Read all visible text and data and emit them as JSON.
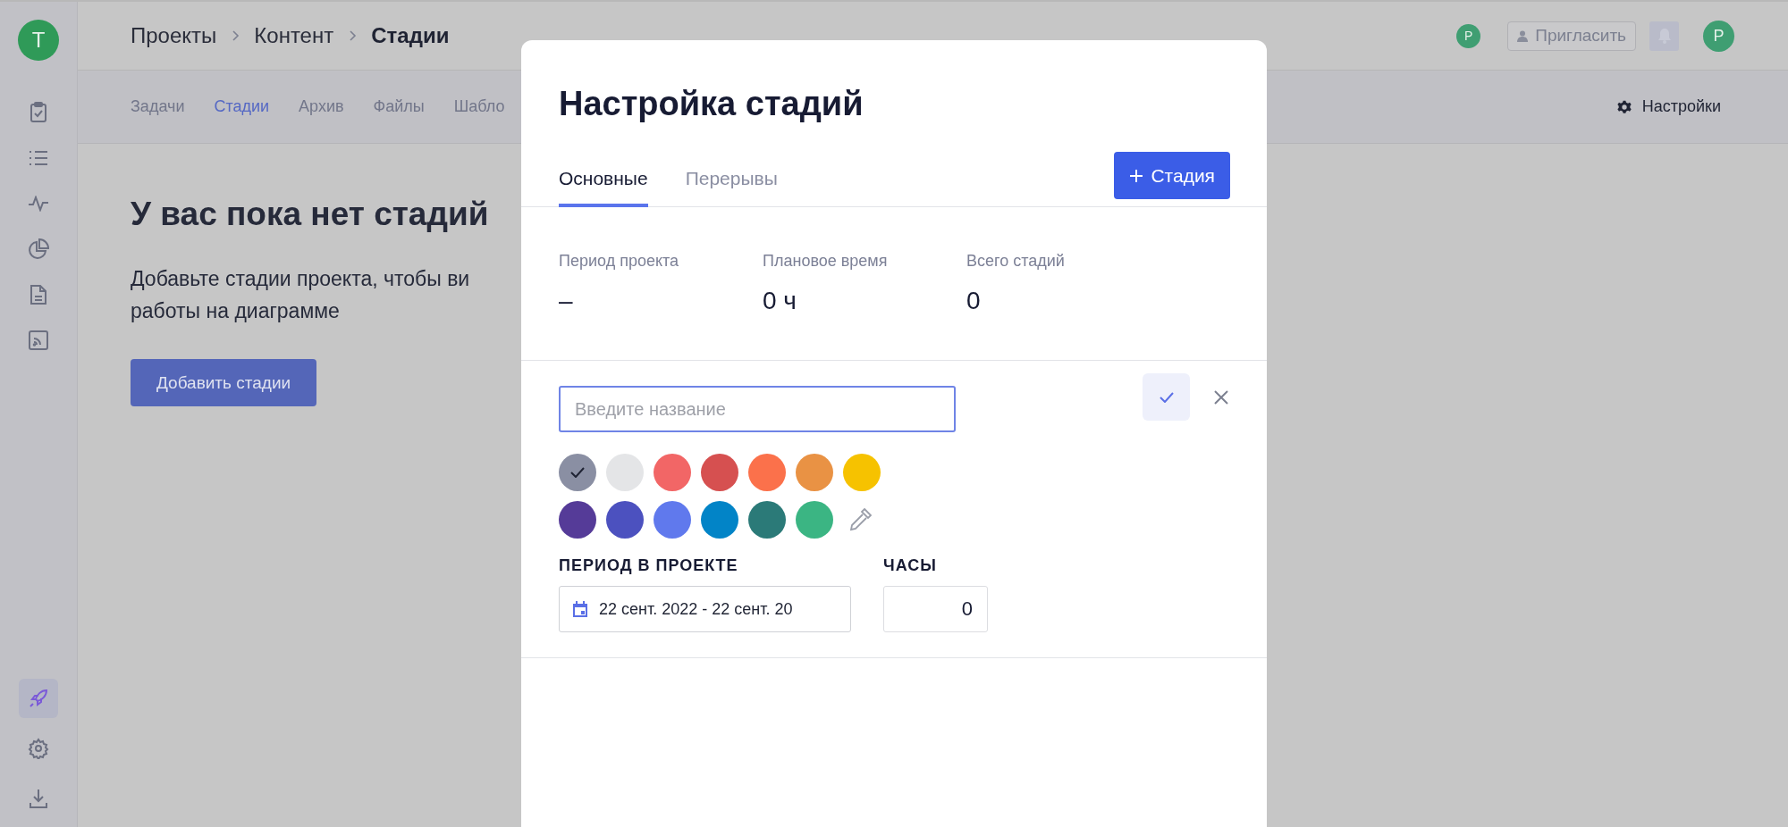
{
  "sidebar": {
    "avatar": "T",
    "items": [
      {
        "kind": "clipboard",
        "selected": false
      },
      {
        "kind": "list",
        "selected": false
      },
      {
        "kind": "pulse",
        "selected": false
      },
      {
        "kind": "pie",
        "selected": false
      },
      {
        "kind": "document",
        "selected": false
      },
      {
        "kind": "feed",
        "selected": false
      }
    ],
    "bottom_items": [
      {
        "kind": "rocket",
        "selected": true
      },
      {
        "kind": "settings",
        "selected": false
      },
      {
        "kind": "download",
        "selected": false
      }
    ]
  },
  "header": {
    "breadcrumbs": [
      "Проекты",
      "Контент",
      "Стадии"
    ],
    "member_avatar": "P",
    "invite_button": "Пригласить",
    "user_avatar": "P"
  },
  "subnav": {
    "tabs": [
      {
        "label": "Задачи",
        "selected": false
      },
      {
        "label": "Стадии",
        "selected": true
      },
      {
        "label": "Архив",
        "selected": false
      },
      {
        "label": "Файлы",
        "selected": false
      },
      {
        "label": "Шабло",
        "selected": false
      }
    ],
    "settings_link": "Настройки"
  },
  "empty_state": {
    "title": "У вас пока нет стадий",
    "lines": [
      "Добавьте стадии проекта, чтобы ви",
      "работы на диаграмме"
    ],
    "button": "Добавить стадии"
  },
  "modal": {
    "title": "Настройка стадий",
    "tabs": [
      {
        "label": "Основные",
        "selected": true
      },
      {
        "label": "Перерывы",
        "selected": false
      }
    ],
    "add_button": "Стадия",
    "stats": [
      {
        "label": "Период проекта",
        "value": "–"
      },
      {
        "label": "Плановое время",
        "value": "0 ч"
      },
      {
        "label": "Всего стадий",
        "value": "0"
      }
    ],
    "form": {
      "name_placeholder": "Введите название",
      "colors": [
        {
          "color": "#8a8fa3",
          "selected": true
        },
        {
          "color": "#e4e5e7",
          "selected": false
        },
        {
          "color": "#f26666",
          "selected": false
        },
        {
          "color": "#d65050",
          "selected": false
        },
        {
          "color": "#fb714b",
          "selected": false
        },
        {
          "color": "#e99244",
          "selected": false
        },
        {
          "color": "#f6c200",
          "selected": false
        },
        {
          "color": "#553b98",
          "selected": false
        },
        {
          "color": "#4c51bf",
          "selected": false
        },
        {
          "color": "#6079ed",
          "selected": false
        },
        {
          "color": "#0284c7",
          "selected": false
        },
        {
          "color": "#2b7a78",
          "selected": false
        },
        {
          "color": "#3bb583",
          "selected": false
        }
      ],
      "period_label": "ПЕРИОД В ПРОЕКТЕ",
      "period_value": "22 сент. 2022 - 22 сент. 20",
      "hours_label": "ЧАСЫ",
      "hours_value": "0"
    }
  }
}
